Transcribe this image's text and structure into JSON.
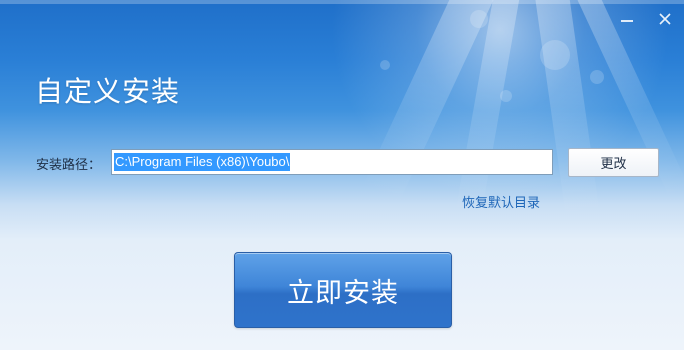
{
  "window": {
    "title": "自定义安装",
    "controls": {
      "minimize_icon": "minimize-icon",
      "close_icon": "close-icon",
      "close_glyph": "✕"
    }
  },
  "install_path": {
    "label": "安装路径：",
    "value": "C:\\Program Files (x86)\\Youbo\\",
    "change_button_label": "更改",
    "restore_default_link": "恢复默认目录"
  },
  "actions": {
    "install_now_label": "立即安装"
  },
  "colors": {
    "header_blue": "#2a7fd6",
    "link_blue": "#1e66b8",
    "selection_blue": "#3399ff",
    "install_button": "#3f85d8"
  }
}
